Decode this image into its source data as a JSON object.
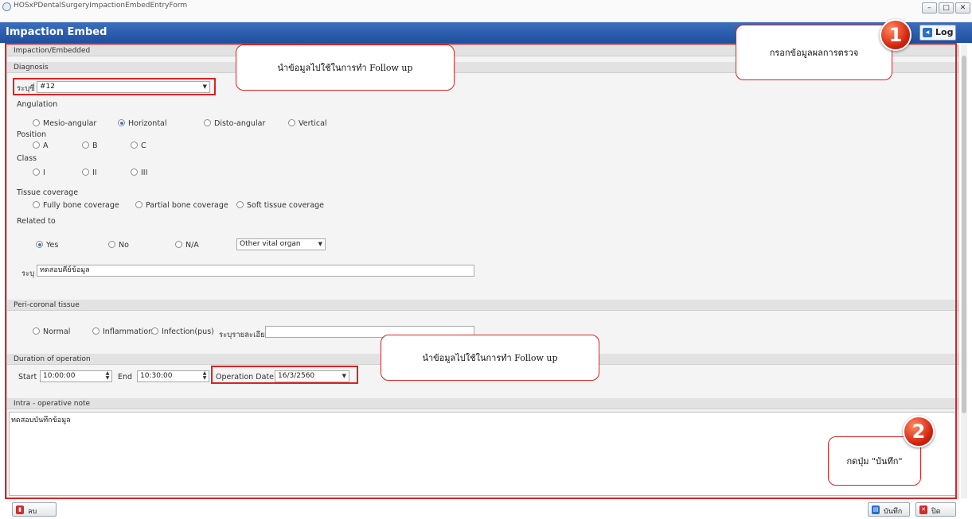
{
  "window": {
    "title": "HOSxPDentalSurgeryImpactionEmbedEntryForm",
    "min_label": "–",
    "max_label": "□",
    "close_label": "✕"
  },
  "header": {
    "title": "Impaction Embed",
    "log_label": "Log"
  },
  "form": {
    "group_title": "Impaction/Embedded",
    "diagnosis": {
      "section": "Diagnosis",
      "tooth_label": "ระบุซี่",
      "tooth_value": "#12"
    },
    "angulation": {
      "label": "Angulation",
      "options": [
        "Mesio-angular",
        "Horizontal",
        "Disto-angular",
        "Vertical"
      ],
      "selected": "Horizontal"
    },
    "position": {
      "label": "Position",
      "options": [
        "A",
        "B",
        "C"
      ]
    },
    "class": {
      "label": "Class",
      "options": [
        "I",
        "II",
        "III"
      ]
    },
    "tissue": {
      "label": "Tissue coverage",
      "options": [
        "Fully bone coverage",
        "Partial bone coverage",
        "Soft tissue coverage"
      ]
    },
    "related": {
      "label": "Related to",
      "options": [
        "Yes",
        "No",
        "N/A"
      ],
      "selected": "Yes",
      "organ_value": "Other vital organ",
      "specify_label": "ระบุ",
      "specify_value": "ทดสอบคีย์ข้อมูล"
    },
    "pericoronal": {
      "section": "Peri-coronal tissue",
      "options": [
        "Normal",
        "Inflammation",
        "Infection(pus)"
      ],
      "detail_label": "ระบุรายละเอียด",
      "detail_value": ""
    },
    "duration": {
      "section": "Duration of operation",
      "start_label": "Start",
      "start_value": "10:00:00",
      "end_label": "End",
      "end_value": "10:30:00",
      "op_date_label": "Operation Date",
      "op_date_value": "16/3/2560"
    },
    "note": {
      "section": "Intra - operative note",
      "value": "ทดสอบบันทึกข้อมูล"
    }
  },
  "callouts": {
    "top_left": "นำข้อมูลไปใช้ในการทำ Follow up",
    "middle": "นำข้อมูลไปใช้ในการทำ Follow up",
    "step1_text": "กรอกข้อมูลผลการตรวจ",
    "step1_number": "1",
    "step2_text": "กดปุ่ม \"บันทึก\"",
    "step2_number": "2"
  },
  "footer": {
    "delete_label": "ลบ",
    "save_label": "บันทึก",
    "close_label": "ปิด"
  },
  "colors": {
    "header_blue": "#1f4f9f",
    "annotation_red": "#d22222"
  }
}
